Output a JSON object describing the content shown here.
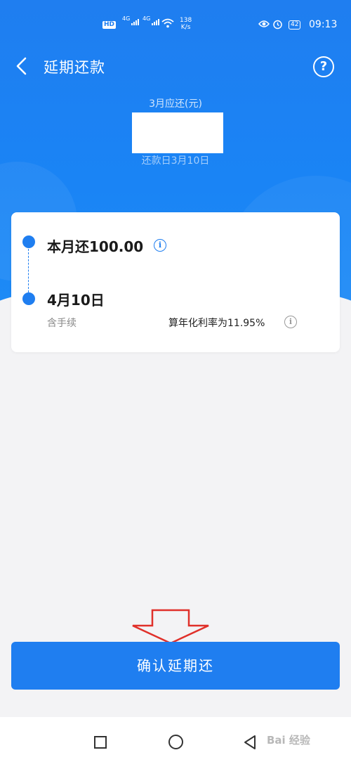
{
  "status_bar": {
    "hd_badge": "HD",
    "sim1_label": "4G",
    "sim2_label": "4G",
    "speed_value": "138",
    "speed_unit": "K/s",
    "battery": "42",
    "time": "09:13",
    "icons": [
      "signal-icon",
      "wifi-icon",
      "eye-icon",
      "alarm-icon",
      "battery-icon"
    ]
  },
  "header": {
    "title": "延期还款",
    "back_icon": "chevron-left-icon",
    "help_icon": "question-icon",
    "help_glyph": "?"
  },
  "summary": {
    "due_label": "3月应还(元)",
    "due_date": "还款日3月10日"
  },
  "plan_card": {
    "this_month": "本月还100.00",
    "next_date": "4月10日",
    "fee_note": "含手续",
    "rate_note": "算年化利率为11.95%",
    "info_glyph": "i"
  },
  "actions": {
    "confirm_label": "确认延期还"
  },
  "watermark": "Bai 经验",
  "colors": {
    "brand_blue": "#1f7ef0",
    "annotation_red": "#e0302a",
    "background": "#f3f3f5"
  }
}
